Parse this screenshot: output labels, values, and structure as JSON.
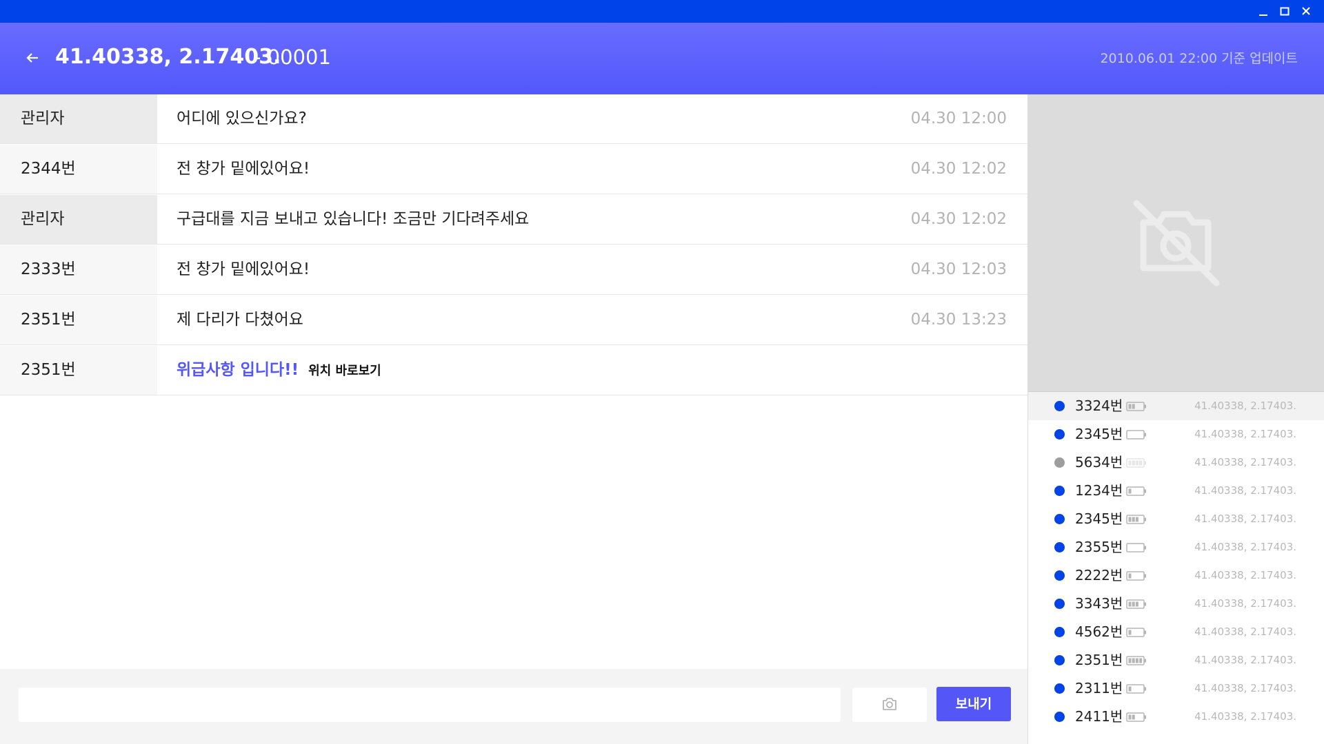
{
  "window": {
    "controls": [
      "minimize",
      "maximize",
      "close"
    ]
  },
  "header": {
    "title": "41.40338, 2.17403.",
    "id": "- 00001",
    "updated": "2010.06.01 22:00 기준 업데이트",
    "back_icon": "arrow-left-icon"
  },
  "messages": [
    {
      "sender": "관리자",
      "text": "어디에 있으신가요?",
      "time": "04.30  12:00",
      "is_admin": true
    },
    {
      "sender": "2344번",
      "text": "전 창가 밑에있어요!",
      "time": "04.30  12:02",
      "is_admin": false
    },
    {
      "sender": "관리자",
      "text": "구급대를 지금 보내고 있습니다! 조금만 기다려주세요",
      "time": "04.30  12:02",
      "is_admin": true
    },
    {
      "sender": "2333번",
      "text": "전 창가 밑에있어요!",
      "time": "04.30 12:03",
      "is_admin": false
    },
    {
      "sender": "2351번",
      "text": "제 다리가 다쳤어요",
      "time": "04.30 13:23",
      "is_admin": false
    }
  ],
  "emergency_message": {
    "sender": "2351번",
    "text": "위급사항 입니다!!",
    "link": "위치 바로보기"
  },
  "input": {
    "value": "",
    "placeholder": "",
    "camera_icon": "camera-icon",
    "send_label": "보내기"
  },
  "camera_preview": {
    "icon": "camera-off-icon"
  },
  "devices": [
    {
      "name": "3324번",
      "coords": "41.40338, 2.17403.",
      "online": true,
      "battery": 0.5,
      "selected": true
    },
    {
      "name": "2345번",
      "coords": "41.40338, 2.17403.",
      "online": true,
      "battery": 0,
      "selected": false
    },
    {
      "name": "5634번",
      "coords": "41.40338, 2.17403.",
      "online": false,
      "battery": 1,
      "selected": false
    },
    {
      "name": "1234번",
      "coords": "41.40338, 2.17403.",
      "online": true,
      "battery": 0.25,
      "selected": false
    },
    {
      "name": "2345번",
      "coords": "41.40338, 2.17403.",
      "online": true,
      "battery": 0.75,
      "selected": false
    },
    {
      "name": "2355번",
      "coords": "41.40338, 2.17403.",
      "online": true,
      "battery": 0,
      "selected": false
    },
    {
      "name": "2222번",
      "coords": "41.40338, 2.17403.",
      "online": true,
      "battery": 0.25,
      "selected": false
    },
    {
      "name": "3343번",
      "coords": "41.40338, 2.17403.",
      "online": true,
      "battery": 0.75,
      "selected": false
    },
    {
      "name": "4562번",
      "coords": "41.40338, 2.17403.",
      "online": true,
      "battery": 0.25,
      "selected": false
    },
    {
      "name": "2351번",
      "coords": "41.40338, 2.17403.",
      "online": true,
      "battery": 1,
      "selected": false
    },
    {
      "name": "2311번",
      "coords": "41.40338, 2.17403.",
      "online": true,
      "battery": 0.25,
      "selected": false
    },
    {
      "name": "2411번",
      "coords": "41.40338, 2.17403.",
      "online": true,
      "battery": 0.5,
      "selected": false
    }
  ],
  "colors": {
    "titlebar": "#0043e8",
    "accent": "#5457f6",
    "online": "#0043e8",
    "offline": "#9e9e9e",
    "admin_row": "#ebebeb",
    "user_row": "#f7f7f7"
  }
}
